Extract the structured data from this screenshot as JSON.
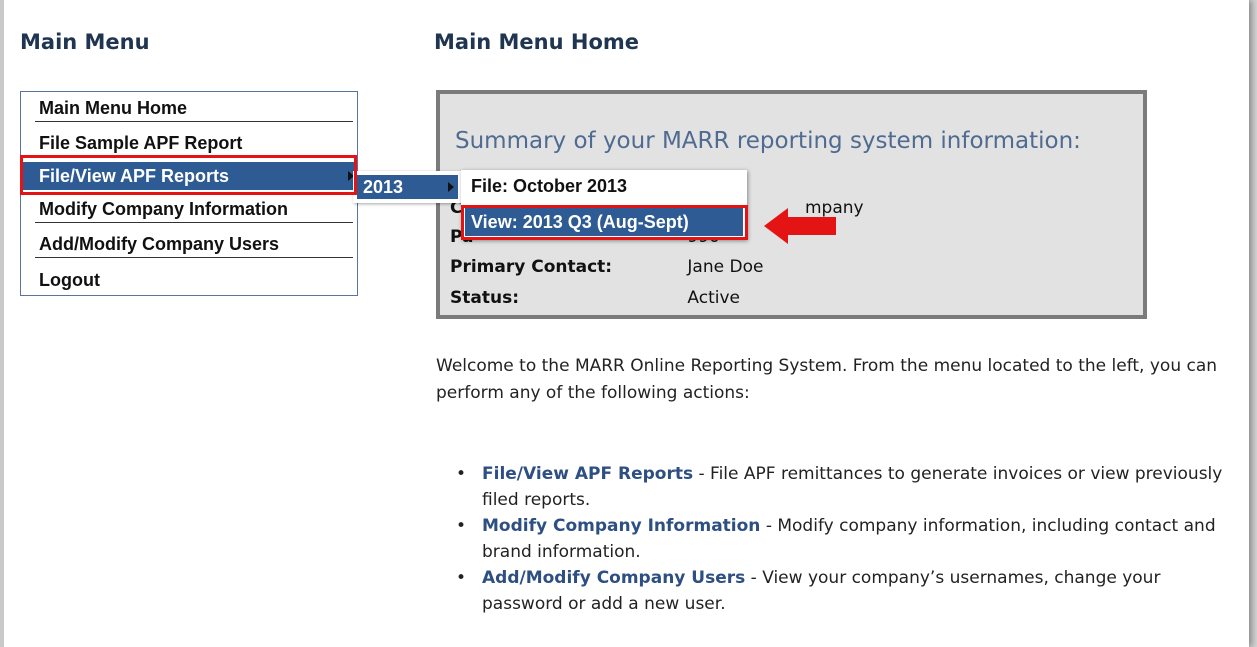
{
  "left_column": {
    "title": "Main Menu",
    "items": [
      {
        "label": "Main Menu Home"
      },
      {
        "label": "File Sample APF Report"
      },
      {
        "label": "File/View APF Reports"
      },
      {
        "label": "Modify Company Information"
      },
      {
        "label": "Add/Modify Company Users"
      },
      {
        "label": "Logout"
      }
    ]
  },
  "flyout_year": {
    "label": "2013"
  },
  "flyout_reports": {
    "items": [
      {
        "label": "File: October 2013"
      },
      {
        "label": "View: 2013 Q3 (Aug-Sept)"
      }
    ]
  },
  "main": {
    "title": "Main Menu Home",
    "summary": {
      "heading": "Summary of your MARR reporting system information:",
      "company_partial": "C",
      "company_tail": "mpany",
      "participant_partial": "Pa",
      "participant_value_partial": "990",
      "primary_contact_label": "Primary Contact:",
      "primary_contact_value": "Jane Doe",
      "status_label": "Status:",
      "status_value": "Active"
    },
    "welcome": "Welcome to the MARR Online Reporting System. From the menu located to the left, you can perform any of the following actions:",
    "actions": [
      {
        "link": "File/View APF Reports",
        "desc": " - File APF remittances to generate invoices or view previously filed reports."
      },
      {
        "link": "Modify Company Information",
        "desc": " - Modify company information, including contact and brand information."
      },
      {
        "link": "Add/Modify Company Users",
        "desc": " - View your company’s usernames, change your password or add a new user."
      }
    ]
  },
  "colors": {
    "accent": "#2e5b93",
    "highlight": "#e41414",
    "title": "#1f3550"
  }
}
